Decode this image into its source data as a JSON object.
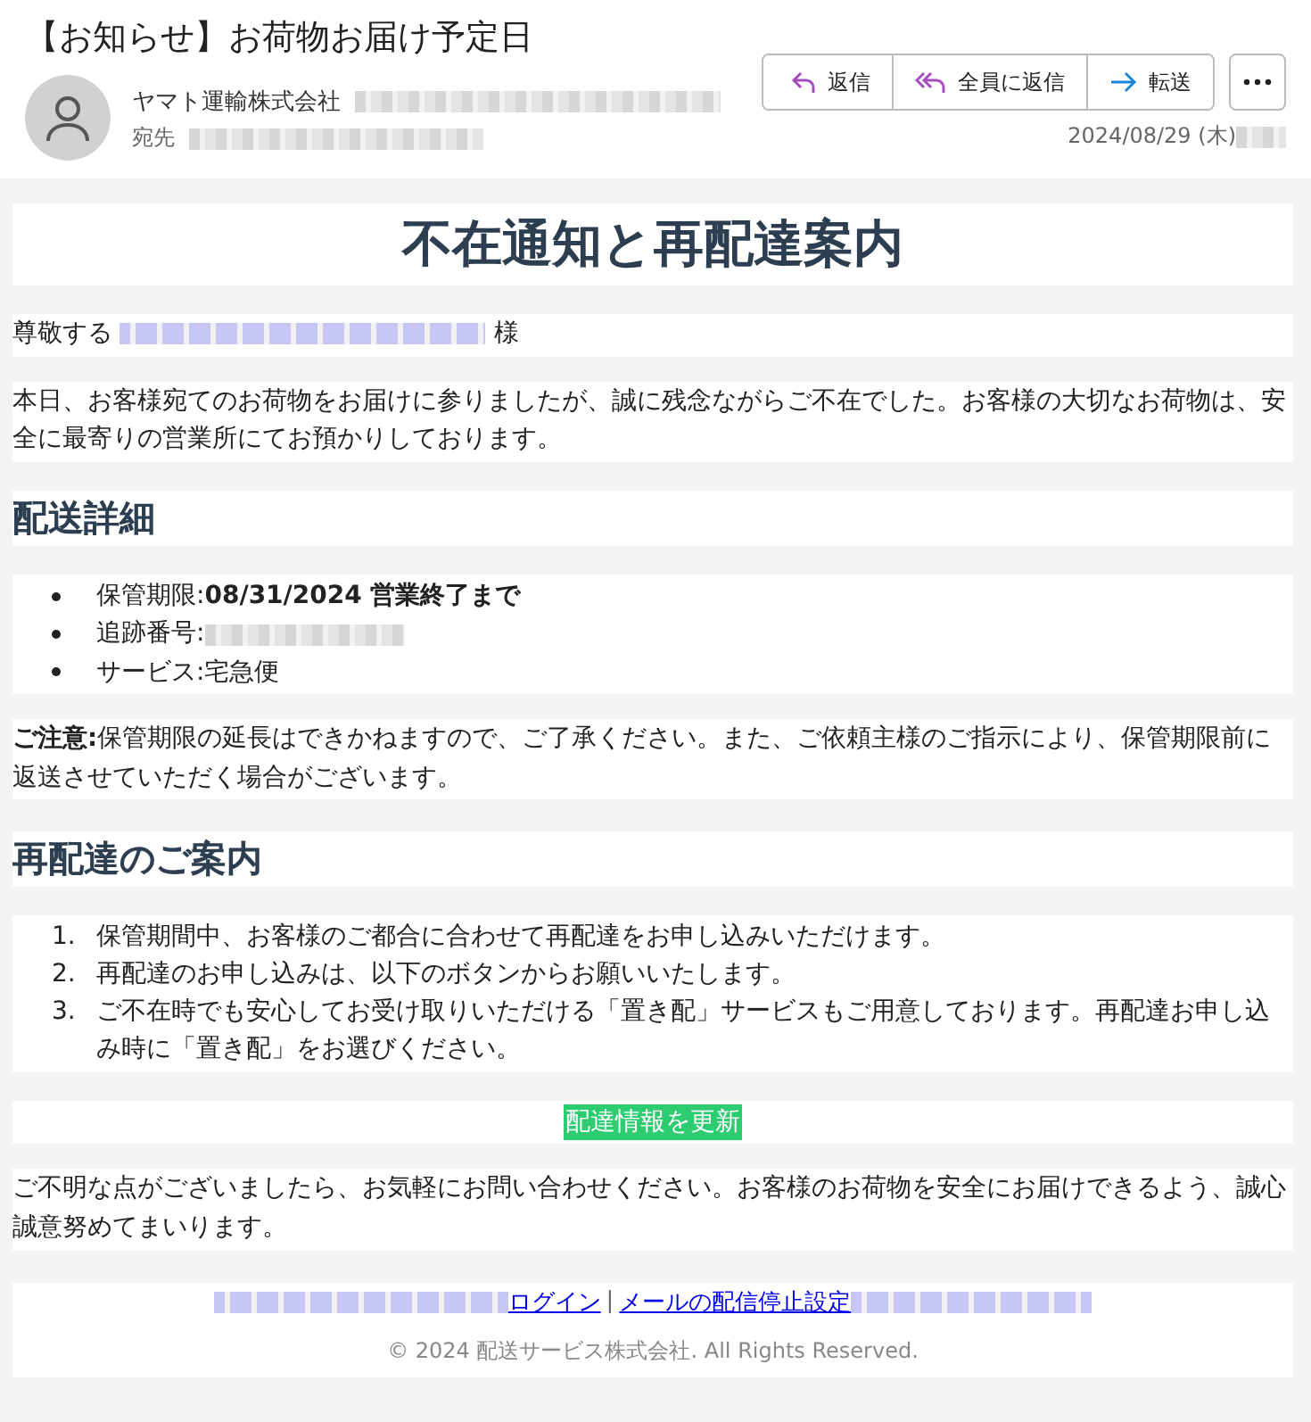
{
  "email": {
    "subject": "【お知らせ】お荷物お届け予定日",
    "sender": "ヤマト運輸株式会社",
    "to_label": "宛先",
    "date": "2024/08/29 (木)",
    "actions": [
      {
        "label": "返信",
        "kind": "reply"
      },
      {
        "label": "全員に返信",
        "kind": "reply_all"
      },
      {
        "label": "転送",
        "kind": "forward"
      }
    ]
  },
  "body": {
    "title": "不在通知と再配達案内",
    "greeting_prefix": "尊敬する",
    "greeting_suffix": "様",
    "intro": "本日、お客様宛てのお荷物をお届けに参りましたが、誠に残念ながらご不在でした。お客様の大切なお荷物は、安全に最寄りの営業所にてお預かりしております。",
    "details_heading": "配送詳細",
    "details": [
      {
        "label": "保管期限:",
        "value": "08/31/2024 営業終了まで",
        "kind": "bold"
      },
      {
        "label": "追跡番号:",
        "kind": "redacted"
      },
      {
        "label": "サービス:",
        "value": "宅急便",
        "kind": "plain"
      }
    ],
    "notice": "**ご注意:**保管期限の延長はできかねますので、ご了承ください。また、ご依頼主様のご指示により、保管期限前に返送させていただく場合がございます。",
    "redelivery_heading": "再配達のご案内",
    "steps": [
      {
        "number": "1.",
        "text": "保管期間中、お客様のご都合に合わせて再配達をお申し込みいただけます。"
      },
      {
        "number": "2.",
        "text": "再配達のお申し込みは、以下のボタンからお願いいたします。"
      },
      {
        "number": "3.",
        "text": "ご不在時でも安心してお受け取りいただける「置き配」サービスもご用意しております。再配達お申し込み時に「置き配」をお選びください。"
      }
    ],
    "button": "配達情報を更新",
    "closing": "ご不明な点がございましたら、お気軽にお問い合わせください。お客様のお荷物を安全にお届けできるよう、誠心誠意努めてまいります。",
    "footer_links": [
      "ログイン",
      "メールの配信停止設定"
    ],
    "separator": "|",
    "copyright": "© 2024 配送サービス株式会社. All Rights Reserved."
  }
}
